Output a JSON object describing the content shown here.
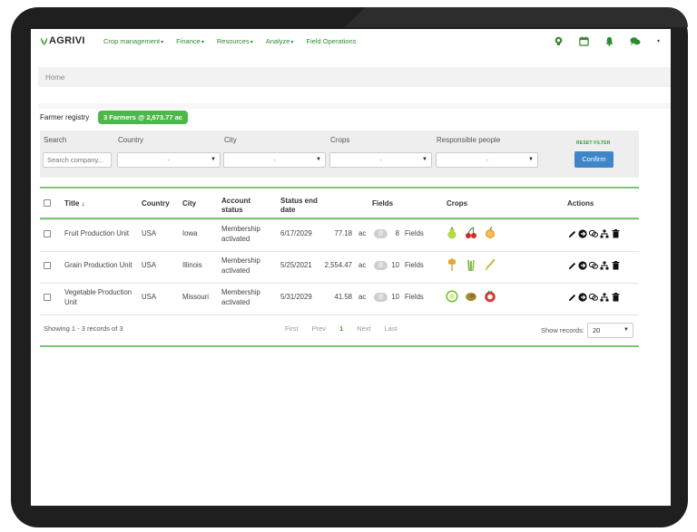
{
  "app": {
    "logo_text": "AGRIVI"
  },
  "nav": {
    "menu": [
      {
        "label": "Crop management",
        "caret": "▾"
      },
      {
        "label": "Finance",
        "caret": "▾"
      },
      {
        "label": "Resources",
        "caret": "▾"
      },
      {
        "label": "Analyze",
        "caret": "▾"
      },
      {
        "label": "Field Operations",
        "caret": ""
      }
    ],
    "icons": [
      "lightbulb-icon",
      "calendar-icon",
      "bell-icon",
      "chat-icon"
    ],
    "account_caret": "▾"
  },
  "breadcrumb": {
    "home": "Home"
  },
  "registry": {
    "label": "Farmer registry",
    "badge": "3 Farmers @ 2,673.77 ac"
  },
  "filters": {
    "search": {
      "label": "Search",
      "placeholder": "Search company..."
    },
    "country": {
      "label": "Country",
      "value": "-"
    },
    "city": {
      "label": "City",
      "value": "-"
    },
    "crops": {
      "label": "Crops",
      "value": "-"
    },
    "responsible": {
      "label": "Responsible people",
      "value": "-"
    },
    "reset_label": "RESET FILTER",
    "confirm_label": "Confirm"
  },
  "table": {
    "headers": {
      "title": "Title ↓",
      "country": "Country",
      "city": "City",
      "account_status": "Account status",
      "status_end_date": "Status end date",
      "fields": "Fields",
      "crops": "Crops",
      "actions": "Actions"
    },
    "rows": [
      {
        "title": "Fruit Production Unit",
        "country": "USA",
        "city": "Iowa",
        "account_status": "Membership activated",
        "status_end_date": "6/17/2029",
        "area": "77.18",
        "area_unit": "ac",
        "fields_count": "8",
        "fields_label": "Fields",
        "crops": [
          "pear-icon",
          "cherry-icon",
          "orange-icon"
        ]
      },
      {
        "title": "Grain Production Unit",
        "country": "USA",
        "city": "Illinois",
        "account_status": "Membership activated",
        "status_end_date": "5/25/2021",
        "area": "2,554.47",
        "area_unit": "ac",
        "fields_count": "10",
        "fields_label": "Fields",
        "crops": [
          "wheat-icon",
          "barley-icon",
          "rye-icon"
        ]
      },
      {
        "title": "Vegetable Production Unit",
        "country": "USA",
        "city": "Missouri",
        "account_status": "Membership activated",
        "status_end_date": "5/31/2029",
        "area": "41.58",
        "area_unit": "ac",
        "fields_count": "10",
        "fields_label": "Fields",
        "crops": [
          "cabbage-icon",
          "potato-icon",
          "radish-icon"
        ]
      }
    ],
    "actions": [
      "edit-icon",
      "navigate-icon",
      "comments-icon",
      "hierarchy-icon",
      "delete-icon"
    ]
  },
  "footer": {
    "showing": "Showing 1 - 3 records of 3",
    "pager": {
      "first": "First",
      "prev": "Prev",
      "current": "1",
      "next": "Next",
      "last": "Last"
    },
    "show_records_label": "Show records:",
    "records_value": "20"
  },
  "colors": {
    "brand_green": "#4cb84a",
    "nav_green": "#2f8a2f",
    "confirm_blue": "#3e86c8",
    "line_green": "#7cc576"
  }
}
